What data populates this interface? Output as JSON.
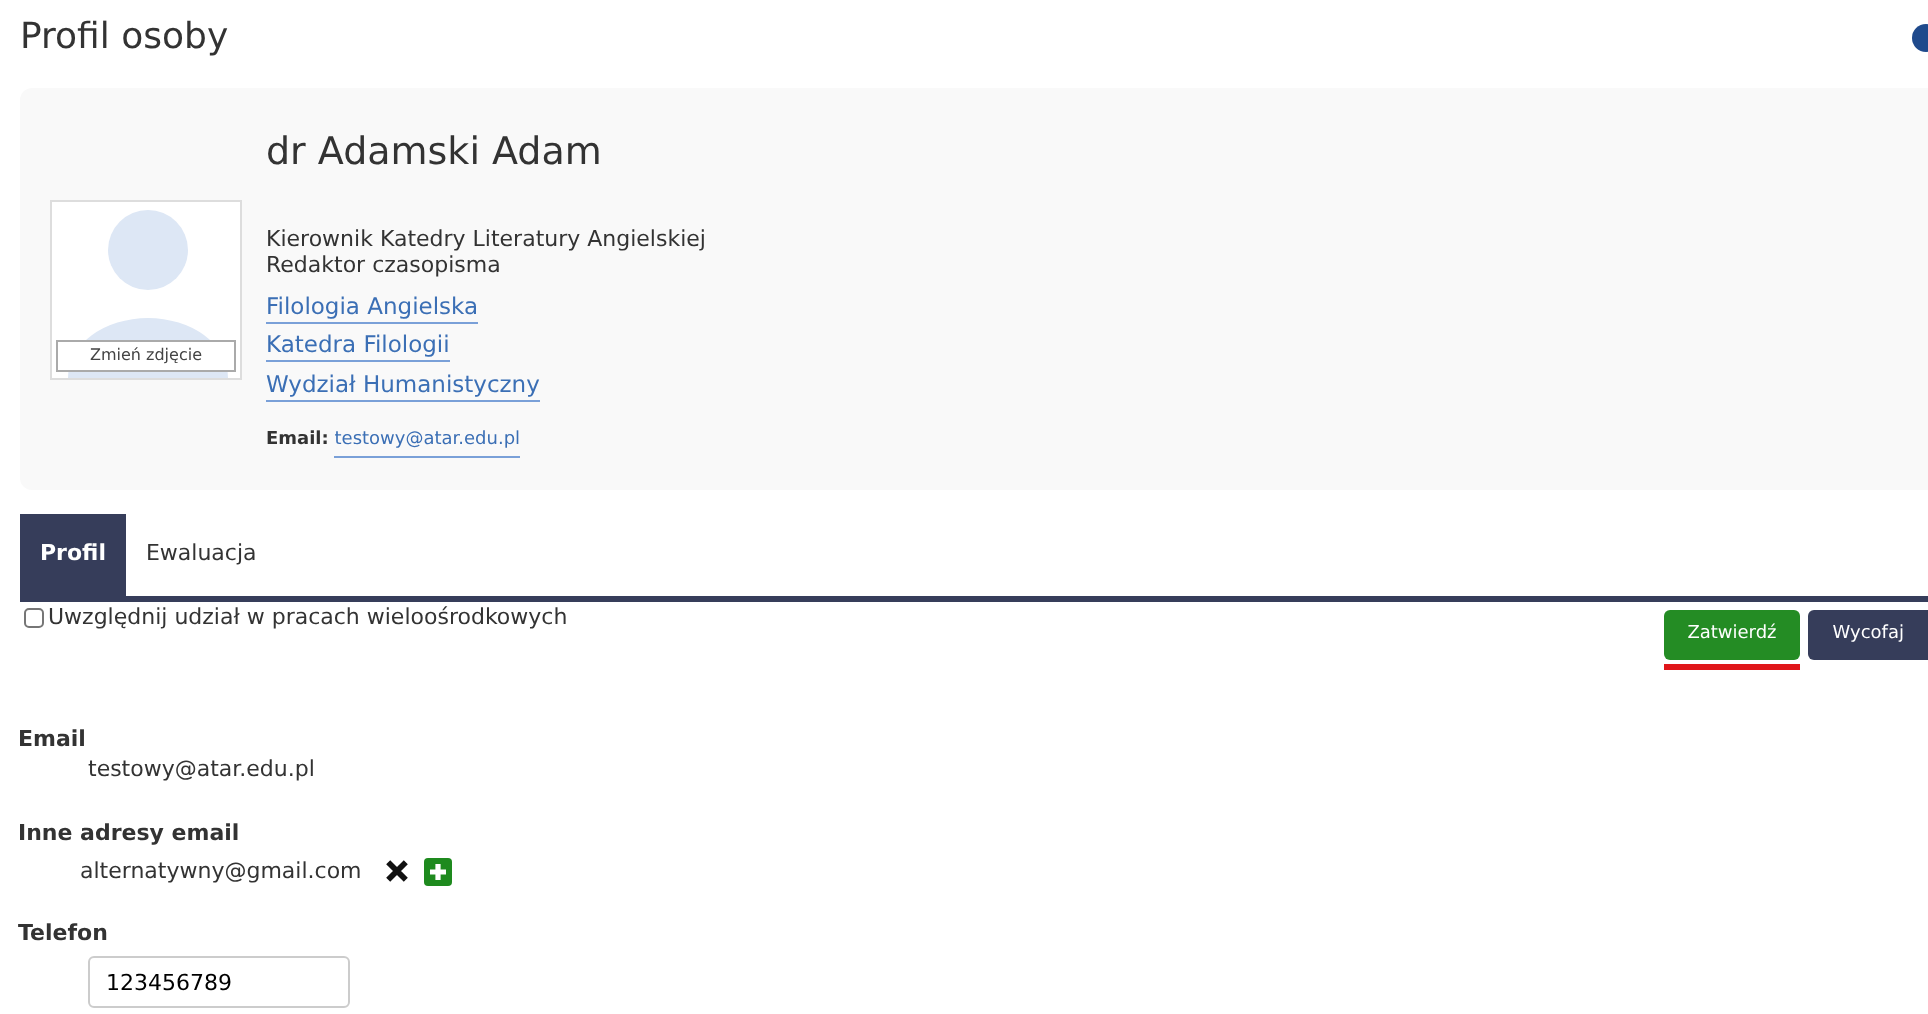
{
  "page_title": "Profil osoby",
  "profile": {
    "name": "dr Adamski Adam",
    "photo_button": "Zmień zdjęcie",
    "positions": [
      "Kierownik Katedry Literatury Angielskiej",
      "Redaktor czasopisma"
    ],
    "units": [
      "Filologia Angielska",
      "Katedra Filologii",
      "Wydział Humanistyczny"
    ],
    "email_label": "Email:",
    "email": "testowy@atar.edu.pl"
  },
  "tabs": [
    {
      "label": "Profil",
      "selected": true
    },
    {
      "label": "Ewaluacja",
      "selected": false
    }
  ],
  "multicenter": {
    "label": "Uwzględnij udział w pracach wieloośrodkowych",
    "checked": false
  },
  "buttons": [
    {
      "label": "Zatwierdź",
      "kind": "confirm",
      "highlighted": true
    },
    {
      "label": "Wycofaj",
      "kind": "cancel",
      "highlighted": false
    }
  ],
  "fields": [
    {
      "label": "Email",
      "kind": "text",
      "value": "testowy@atar.edu.pl"
    },
    {
      "label": "Inne adresy email",
      "kind": "list",
      "value": "alternatywny@gmail.com"
    },
    {
      "label": "Telefon",
      "kind": "input",
      "value": "123456789"
    }
  ]
}
